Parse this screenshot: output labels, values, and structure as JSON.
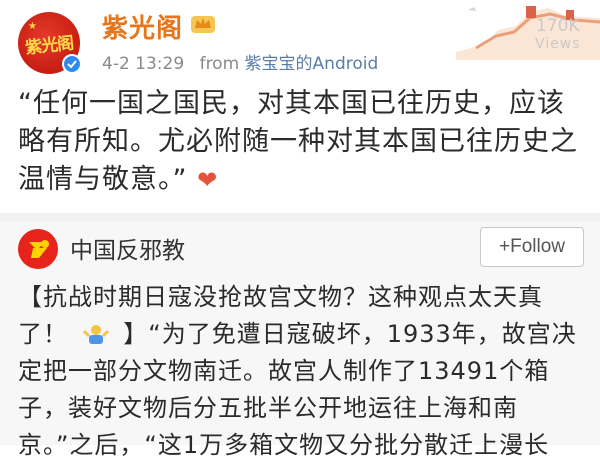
{
  "post": {
    "author": "紫光阁",
    "time": "4-2 13:29",
    "from_prefix": "from",
    "source": "紫宝宝的Android",
    "views_count": "170K",
    "views_label": "Views",
    "avatar_text": "紫光阁",
    "text": "“任何一国之国民，对其本国已往历史，应该略有所知。尤必附随一种对其本国已往历史之温情与敬意。”",
    "emoji_icon": "heart-icon"
  },
  "repost": {
    "author": "中国反邪教",
    "follow_label": "+Follow",
    "text_part1": "【抗战时期日寇没抢故宫文物？这种观点太天真了！",
    "text_part2": "】“为了免遭日寇破坏，1933年，故宫决定把一部分文物南迁。故宫人制作了13491个箱子，装好文物后分五批半公开地运往上海和南京。”之后，“这1万多箱文物又分批分散迁上漫长"
  },
  "colors": {
    "author_name": "#e8751a",
    "link": "#5a7ea8",
    "verified": "#2d8cf0",
    "heart": "#e4533a",
    "avatar_red": "#c81d12"
  }
}
